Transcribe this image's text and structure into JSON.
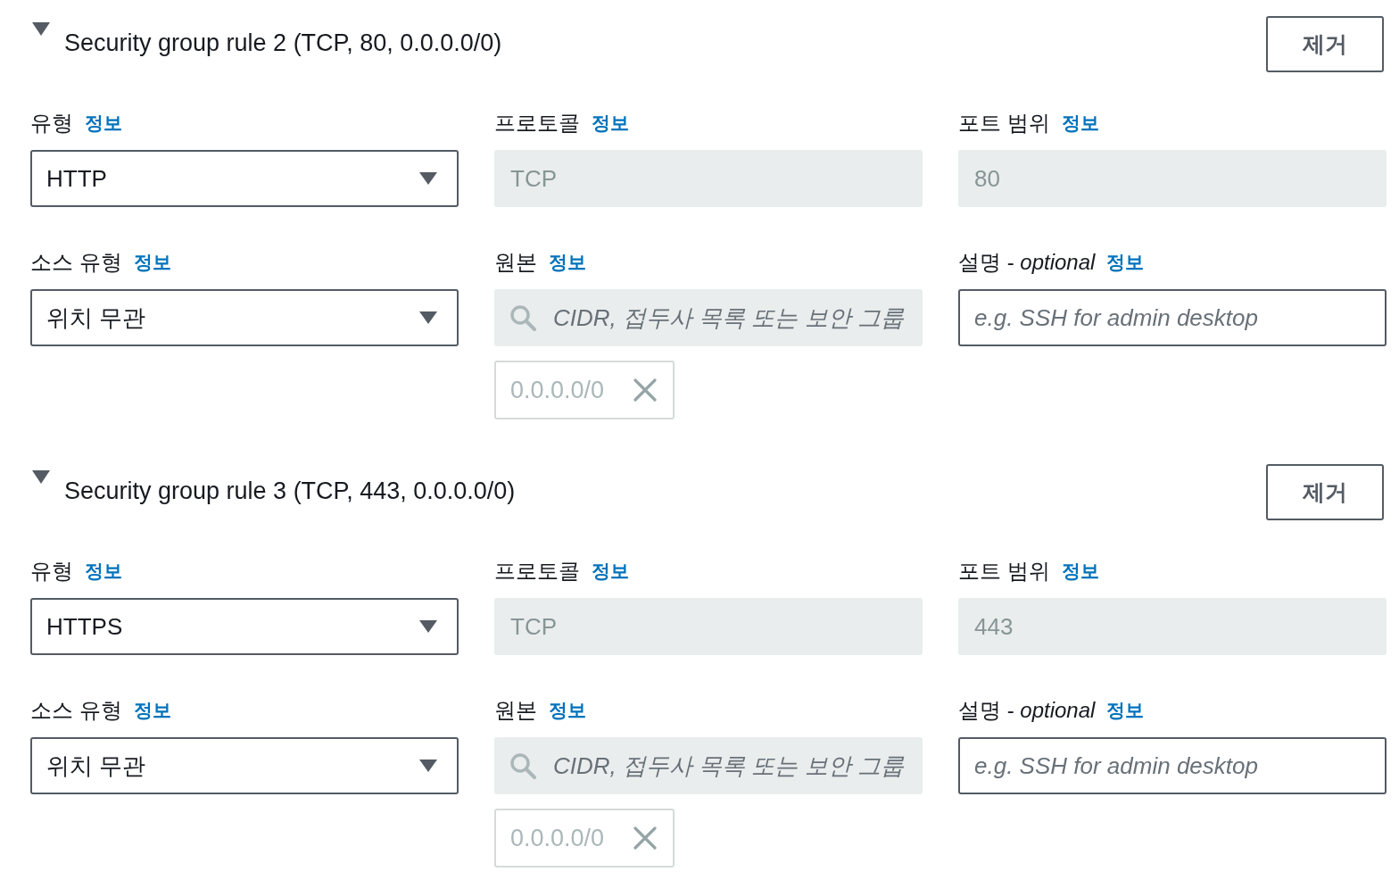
{
  "rules": [
    {
      "title": "Security group rule 2 (TCP, 80, 0.0.0.0/0)",
      "expanded": true,
      "remove_button": "제거",
      "fields": [
        {
          "kind": "select",
          "label": "유형",
          "info": "정보",
          "value": "HTTP",
          "disabled": false
        },
        {
          "kind": "input",
          "label": "프로토콜",
          "info": "정보",
          "value": "TCP",
          "disabled": true
        },
        {
          "kind": "input",
          "label": "포트 범위",
          "info": "정보",
          "value": "80",
          "disabled": true
        },
        {
          "kind": "select",
          "label": "소스 유형",
          "info": "정보",
          "value": "위치 무관",
          "disabled": false
        },
        {
          "kind": "search",
          "label": "원본",
          "info": "정보",
          "placeholder": "CIDR, 접두사 목록 또는 보안 그룹",
          "disabled": true,
          "tokens": [
            "0.0.0.0/0"
          ]
        },
        {
          "kind": "input",
          "label": "설명 - *optional*",
          "info": "정보",
          "placeholder": "e.g. SSH for admin desktop",
          "disabled": false
        }
      ]
    },
    {
      "title": "Security group rule 3 (TCP, 443, 0.0.0.0/0)",
      "expanded": true,
      "remove_button": "제거",
      "fields": [
        {
          "kind": "select",
          "label": "유형",
          "info": "정보",
          "value": "HTTPS",
          "disabled": false
        },
        {
          "kind": "input",
          "label": "프로토콜",
          "info": "정보",
          "value": "TCP",
          "disabled": true
        },
        {
          "kind": "input",
          "label": "포트 범위",
          "info": "정보",
          "value": "443",
          "disabled": true
        },
        {
          "kind": "select",
          "label": "소스 유형",
          "info": "정보",
          "value": "위치 무관",
          "disabled": false
        },
        {
          "kind": "search",
          "label": "원본",
          "info": "정보",
          "placeholder": "CIDR, 접두사 목록 또는 보안 그룹",
          "disabled": true,
          "tokens": [
            "0.0.0.0/0"
          ]
        },
        {
          "kind": "input",
          "label": "설명 - *optional*",
          "info": "정보",
          "placeholder": "e.g. SSH for admin desktop",
          "disabled": false
        }
      ]
    }
  ]
}
